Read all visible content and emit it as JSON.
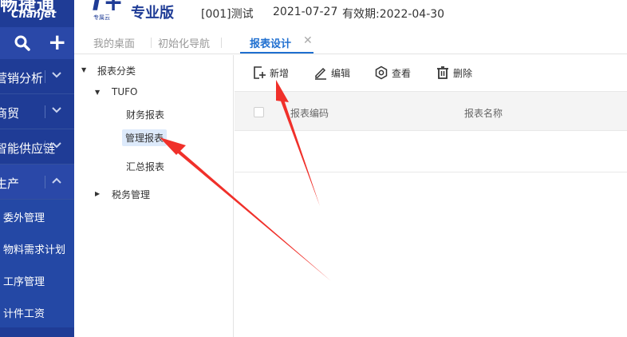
{
  "sidebar": {
    "logo_cn": "畅捷通",
    "logo_en": "Chanjet",
    "items": [
      {
        "label": "营销分析"
      },
      {
        "label": "商贸"
      },
      {
        "label": "智能供应链"
      },
      {
        "label": "生产"
      }
    ],
    "subitems": [
      {
        "label": "委外管理"
      },
      {
        "label": "物料需求计划"
      },
      {
        "label": "工序管理"
      },
      {
        "label": "计件工资"
      }
    ]
  },
  "topbar": {
    "product": "T+",
    "product_sub": "专属云",
    "edition": "专业版",
    "account": "[001]测试",
    "date": "2021-07-27",
    "validity": "有效期:2022-04-30"
  },
  "tabs": [
    {
      "label": "我的桌面"
    },
    {
      "label": "初始化导航"
    },
    {
      "label": "报表设计"
    }
  ],
  "tree": {
    "root": "报表分类",
    "group": "TUFO",
    "children": [
      "财务报表",
      "管理报表",
      "汇总报表"
    ],
    "sibling": "税务管理"
  },
  "toolbar": {
    "add": "新增",
    "edit": "编辑",
    "view": "查看",
    "delete": "删除"
  },
  "grid": {
    "columns": [
      "报表编码",
      "报表名称"
    ]
  },
  "colors": {
    "sidebar": "#1f3c96",
    "accent": "#1f6fd0",
    "annotation_arrow": "#f0302a"
  }
}
